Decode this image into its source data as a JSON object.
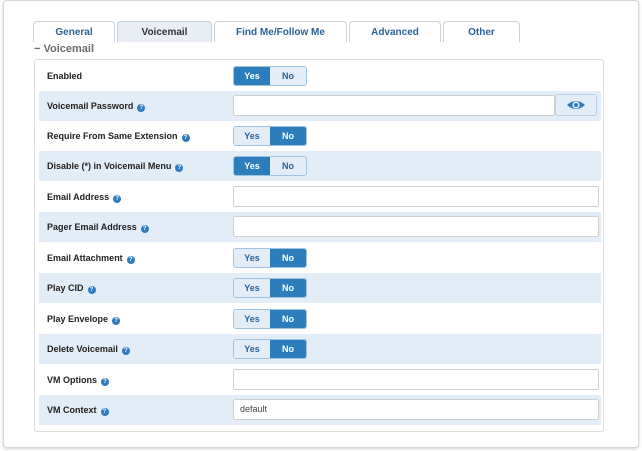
{
  "tabs": [
    {
      "label": "General"
    },
    {
      "label": "Voicemail"
    },
    {
      "label": "Find Me/Follow Me"
    },
    {
      "label": "Advanced"
    },
    {
      "label": "Other"
    }
  ],
  "section": {
    "title": "− Voicemail"
  },
  "fields": {
    "enabled": {
      "label": "Enabled",
      "yes": "Yes",
      "no": "No",
      "selected": "Yes"
    },
    "voicemail_password": {
      "label": "Voicemail Password",
      "value": ""
    },
    "require_same_ext": {
      "label": "Require From Same Extension",
      "yes": "Yes",
      "no": "No",
      "selected": "No"
    },
    "disable_star": {
      "label": "Disable (*) in Voicemail Menu",
      "yes": "Yes",
      "no": "No",
      "selected": "Yes"
    },
    "email_address": {
      "label": "Email Address",
      "value": ""
    },
    "pager_email": {
      "label": "Pager Email Address",
      "value": ""
    },
    "email_attachment": {
      "label": "Email Attachment",
      "yes": "Yes",
      "no": "No",
      "selected": "No"
    },
    "play_cid": {
      "label": "Play CID",
      "yes": "Yes",
      "no": "No",
      "selected": "No"
    },
    "play_envelope": {
      "label": "Play Envelope",
      "yes": "Yes",
      "no": "No",
      "selected": "No"
    },
    "delete_voicemail": {
      "label": "Delete Voicemail",
      "yes": "Yes",
      "no": "No",
      "selected": "No"
    },
    "vm_options": {
      "label": "VM Options",
      "value": ""
    },
    "vm_context": {
      "label": "VM Context",
      "value": "default"
    }
  },
  "help_glyph": "?",
  "icons": {
    "help": "help-icon",
    "eye": "eye-icon"
  },
  "colors": {
    "accent": "#2c7dbb",
    "row_alt": "#e3edf7",
    "link": "#2a6496"
  }
}
